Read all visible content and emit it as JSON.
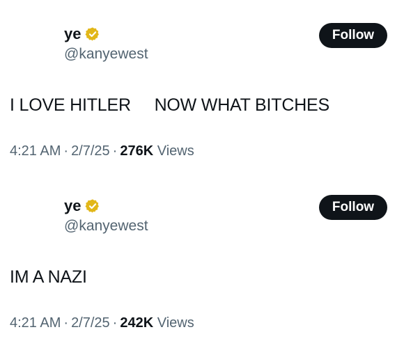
{
  "colors": {
    "text_primary": "#0f1419",
    "text_secondary": "#536471",
    "verified_badge": "#e2b719",
    "follow_button_bg": "#0f1419"
  },
  "tweets": [
    {
      "display_name": "ye",
      "handle": "@kanyewest",
      "verified_icon": "verified-gold-badge-icon",
      "follow_label": "Follow",
      "text": "I LOVE HITLER     NOW WHAT BITCHES",
      "time": "4:21 AM",
      "date": "2/7/25",
      "views_count": "276K",
      "views_label": "Views"
    },
    {
      "display_name": "ye",
      "handle": "@kanyewest",
      "verified_icon": "verified-gold-badge-icon",
      "follow_label": "Follow",
      "text": "IM A NAZI",
      "time": "4:21 AM",
      "date": "2/7/25",
      "views_count": "242K",
      "views_label": "Views"
    }
  ],
  "separator": "·"
}
